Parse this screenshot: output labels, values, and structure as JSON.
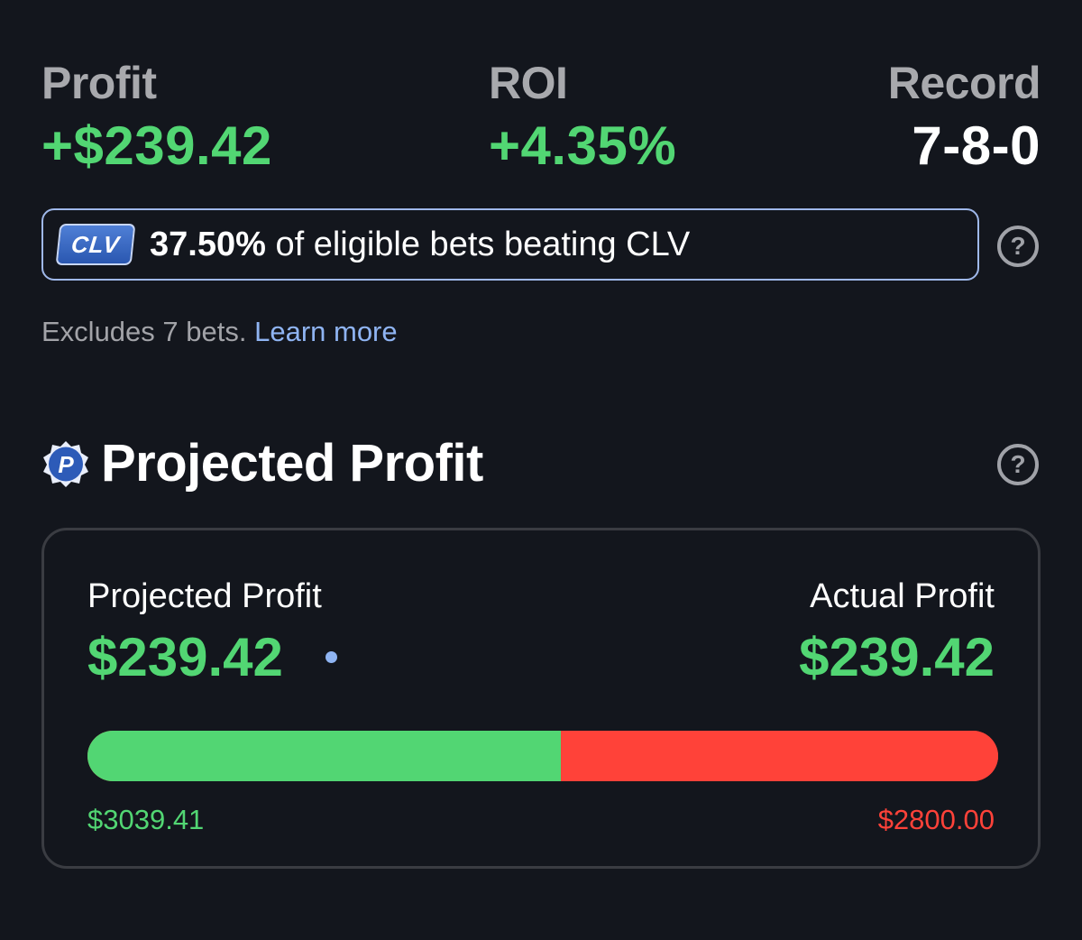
{
  "stats": {
    "profit": {
      "label": "Profit",
      "value": "+$239.42"
    },
    "roi": {
      "label": "ROI",
      "value": "+4.35%"
    },
    "record": {
      "label": "Record",
      "value": "7-8-0"
    }
  },
  "clv": {
    "badge": "CLV",
    "percent": "37.50%",
    "text": " of eligible bets beating CLV",
    "excludes": "Excludes 7 bets.",
    "learn_more": "Learn more"
  },
  "projected_section": {
    "icon_letter": "P",
    "title": "Projected Profit",
    "projected_label": "Projected Profit",
    "projected_value": "$239.42",
    "actual_label": "Actual Profit",
    "actual_value": "$239.42",
    "bar": {
      "green_fraction": 0.52,
      "left_label": "$3039.41",
      "right_label": "$2800.00"
    }
  },
  "colors": {
    "background": "#13161d",
    "green": "#52d673",
    "red": "#ff4239",
    "accent_blue": "#8fb4f2"
  },
  "icons": {
    "help": "question-circle-icon",
    "projected": "p-badge-icon"
  }
}
